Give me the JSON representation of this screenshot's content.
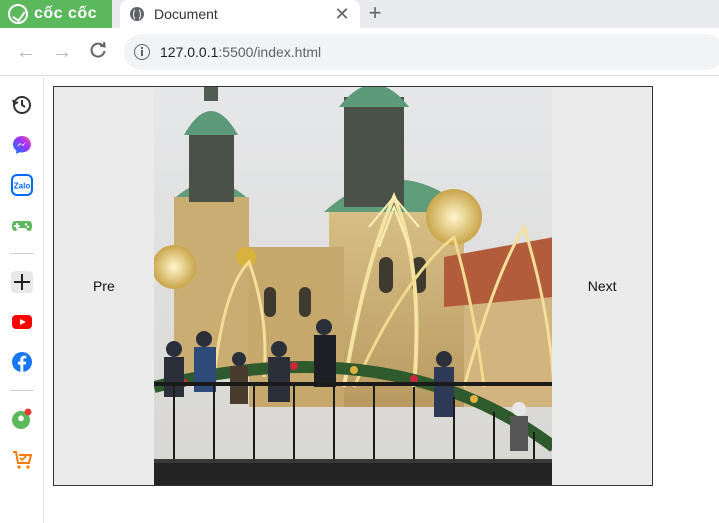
{
  "browser": {
    "brand": "cốc cốc",
    "tab": {
      "title": "Document"
    },
    "address": {
      "host": "127.0.0.1",
      "path": ":5500/index.html"
    }
  },
  "sidebar": {
    "items": [
      "history-icon",
      "messenger-icon",
      "zalo-icon",
      "games-icon",
      "add-icon",
      "youtube-icon",
      "facebook-icon",
      "football-icon",
      "shopping-icon"
    ],
    "zalo_text": "Zalo"
  },
  "slider": {
    "prev_label": "Pre",
    "next_label": "Next"
  },
  "colors": {
    "brand_green": "#5cb85c",
    "button_bg": "#ebebeb"
  }
}
